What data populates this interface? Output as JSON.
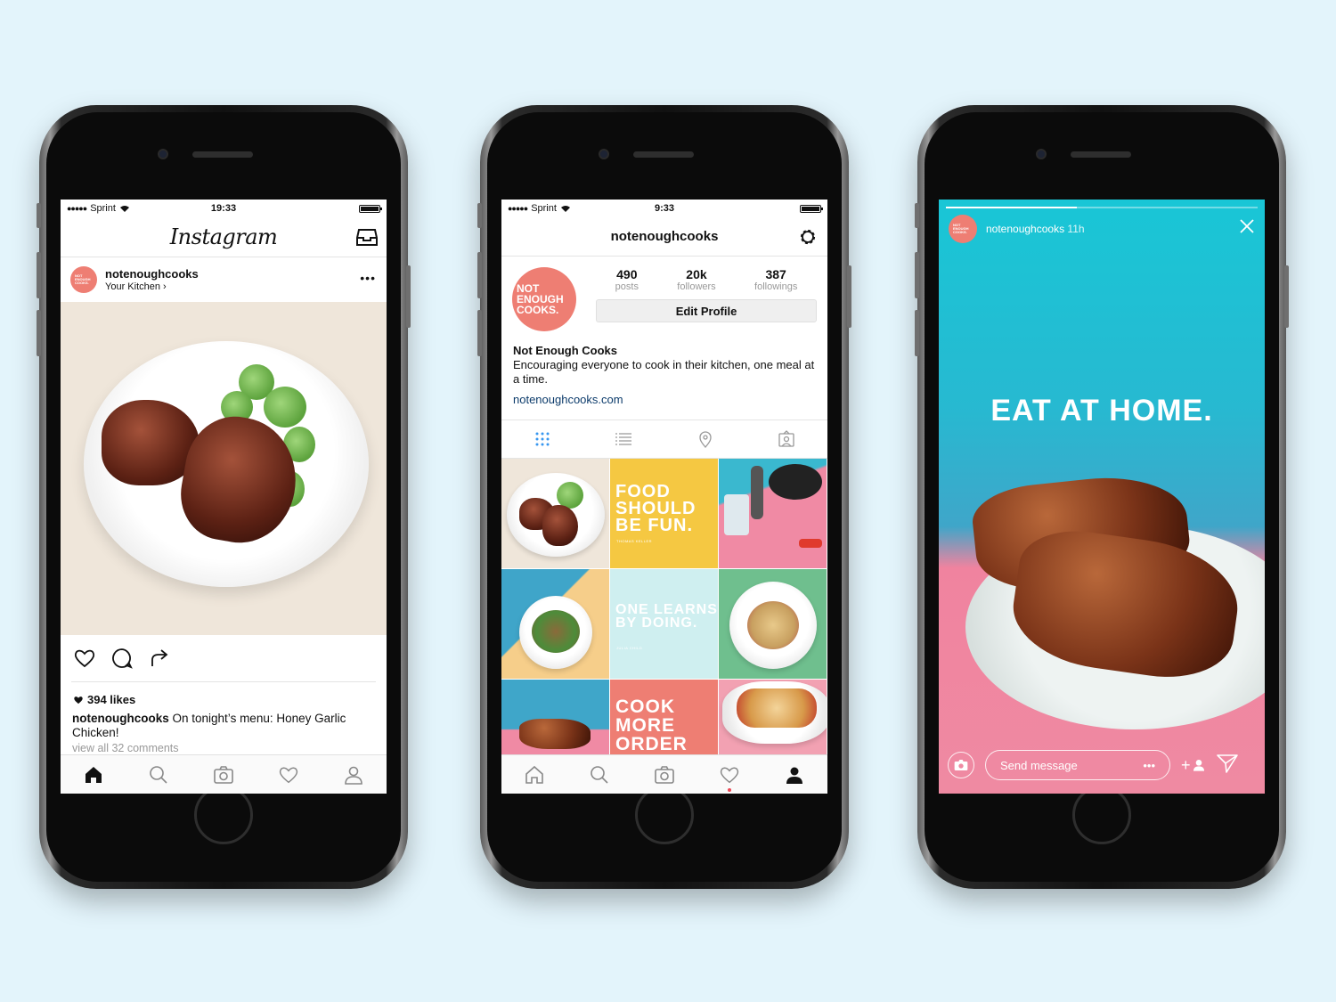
{
  "feed": {
    "status": {
      "carrier": "Sprint",
      "time": "19:33"
    },
    "logo": "Instagram",
    "post": {
      "username": "notenoughcooks",
      "location": "Your Kitchen",
      "chevron": "›",
      "more": "•••",
      "likes": "394 likes",
      "caption_user": "notenoughcooks",
      "caption_text": "On tonight’s menu: Honey Garlic Chicken!",
      "comments_link": "view all 32 comments"
    }
  },
  "profile": {
    "status": {
      "carrier": "Sprint",
      "time": "9:33"
    },
    "username": "notenoughcooks",
    "avatar_text": [
      "NOT",
      "ENOUGH",
      "COOKS."
    ],
    "stats": [
      {
        "value": "490",
        "label": "posts"
      },
      {
        "value": "20k",
        "label": "followers"
      },
      {
        "value": "387",
        "label": "followings"
      }
    ],
    "edit_label": "Edit Profile",
    "bio_name": "Not Enough Cooks",
    "bio_text": "Encouraging everyone to cook in their kitchen, one meal at a time.",
    "bio_link": "notenoughcooks.com",
    "grid_quotes": {
      "q1": {
        "text": "FOOD SHOULD BE FUN.",
        "author": "THOMAS KELLER"
      },
      "q2": {
        "text": "ONE LEARNS BY DOING.",
        "author": "JULIA CHILD"
      },
      "q3": {
        "text": "COOK MORE ORDER"
      }
    }
  },
  "story": {
    "username": "notenoughcooks",
    "age": "11h",
    "headline": "EAT AT HOME.",
    "message_placeholder": "Send message",
    "message_more": "•••",
    "add_person": "+"
  },
  "colors": {
    "brand_coral": "#ee7e73",
    "story_teal": "#19c6d6",
    "story_pink": "#ef8aa2",
    "link_blue": "#0c3b6b",
    "grid_blue": "#3897f0"
  }
}
